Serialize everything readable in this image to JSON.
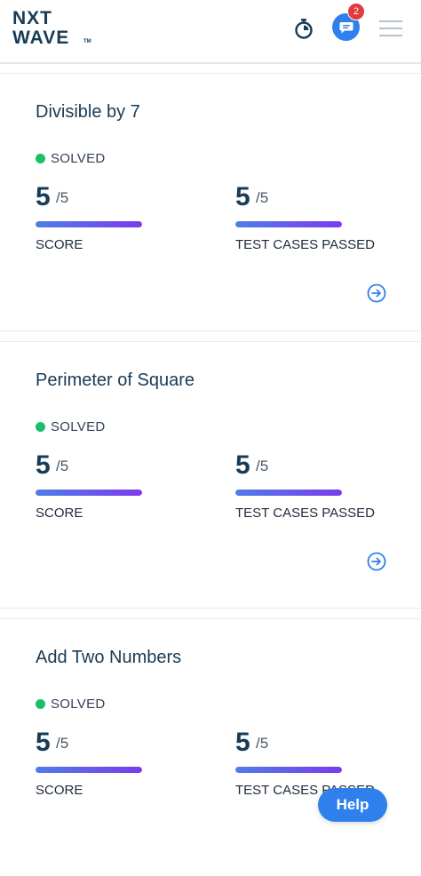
{
  "header": {
    "logo_line1": "NXT",
    "logo_line2": "WAVE",
    "logo_tm": "TM",
    "notification_count": "2",
    "icons": [
      "timer-icon",
      "chat-icon",
      "hamburger-menu-icon"
    ]
  },
  "colors": {
    "brand": "#183b56",
    "accent": "#2f80ed",
    "solved": "#1bbf6a",
    "badge": "#e3393f",
    "progress_start": "#4f7de8",
    "progress_end": "#7c3aed"
  },
  "problems": [
    {
      "title": "Divisible by 7",
      "status": "SOLVED",
      "score": "5",
      "score_total": "/5",
      "score_label": "SCORE",
      "score_progress": 1.0,
      "tests": "5",
      "tests_total": "/5",
      "tests_label": "TEST CASES PASSED",
      "tests_progress": 1.0
    },
    {
      "title": "Perimeter of Square",
      "status": "SOLVED",
      "score": "5",
      "score_total": "/5",
      "score_label": "SCORE",
      "score_progress": 1.0,
      "tests": "5",
      "tests_total": "/5",
      "tests_label": "TEST CASES PASSED",
      "tests_progress": 1.0
    },
    {
      "title": "Add Two Numbers",
      "status": "SOLVED",
      "score": "5",
      "score_total": "/5",
      "score_label": "SCORE",
      "score_progress": 1.0,
      "tests": "5",
      "tests_total": "/5",
      "tests_label": "TEST CASES PASSED",
      "tests_progress": 1.0
    }
  ],
  "help_button": {
    "label": "Help"
  }
}
